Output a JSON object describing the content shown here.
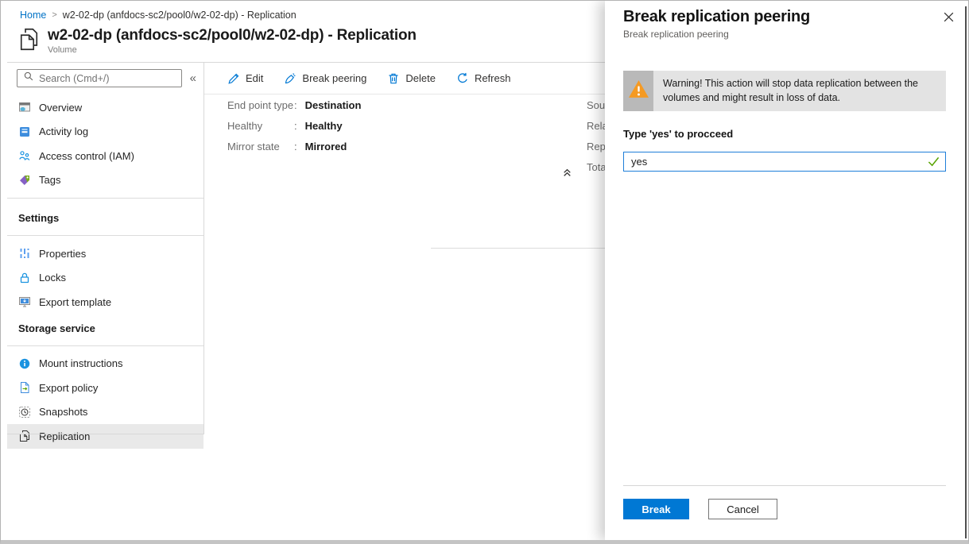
{
  "breadcrumb": {
    "home": "Home",
    "separator": ">",
    "current": "w2-02-dp (anfdocs-sc2/pool0/w2-02-dp) - Replication"
  },
  "header": {
    "title": "w2-02-dp (anfdocs-sc2/pool0/w2-02-dp) - Replication",
    "subtitle": "Volume",
    "icon": "volume-pages-icon"
  },
  "sidebar": {
    "search": {
      "placeholder": "Search (Cmd+/)",
      "icon": "search-icon"
    },
    "collapse_glyph": "«",
    "groups": [
      {
        "items": [
          {
            "label": "Overview",
            "icon": "overview-icon"
          },
          {
            "label": "Activity log",
            "icon": "activity-log-icon"
          },
          {
            "label": "Access control (IAM)",
            "icon": "access-control-icon"
          },
          {
            "label": "Tags",
            "icon": "tags-icon"
          }
        ]
      },
      {
        "header": "Settings",
        "items": [
          {
            "label": "Properties",
            "icon": "properties-icon"
          },
          {
            "label": "Locks",
            "icon": "lock-icon"
          },
          {
            "label": "Export template",
            "icon": "export-template-icon"
          }
        ]
      },
      {
        "header": "Storage service",
        "items": [
          {
            "label": "Mount instructions",
            "icon": "info-icon"
          },
          {
            "label": "Export policy",
            "icon": "export-policy-icon"
          },
          {
            "label": "Snapshots",
            "icon": "snapshots-icon"
          },
          {
            "label": "Replication",
            "icon": "replication-icon",
            "selected": true
          }
        ]
      }
    ]
  },
  "toolbar": {
    "items": [
      {
        "label": "Edit",
        "icon": "edit-icon"
      },
      {
        "label": "Break peering",
        "icon": "break-peering-icon"
      },
      {
        "label": "Delete",
        "icon": "delete-icon"
      },
      {
        "label": "Refresh",
        "icon": "refresh-icon"
      }
    ]
  },
  "replication_details": {
    "rows": [
      {
        "label": "End point type",
        "separator": ":",
        "value": "Destination"
      },
      {
        "label": "Healthy",
        "separator": ":",
        "value": "Healthy"
      },
      {
        "label": "Mirror state",
        "separator": ":",
        "value": "Mirrored"
      }
    ],
    "truncated_labels": [
      "Sou",
      "Rela",
      "Rep",
      "Tota"
    ]
  },
  "panel": {
    "title": "Break replication peering",
    "subtitle": "Break replication peering",
    "warning_text": "Warning! This action will stop data replication between the volumes and might result in loss of data.",
    "confirm_label": "Type 'yes' to procceed",
    "input_value": "yes",
    "break_label": "Break",
    "cancel_label": "Cancel"
  },
  "colors": {
    "accent_blue": "#0078d4",
    "link_blue": "#0072c6",
    "warning_orange": "#f59a23",
    "success_green": "#57a300",
    "warning_bg": "#e3e3e3",
    "warning_stripe": "#b9b9b9",
    "selected_item_bg": "#e9e9e9"
  }
}
